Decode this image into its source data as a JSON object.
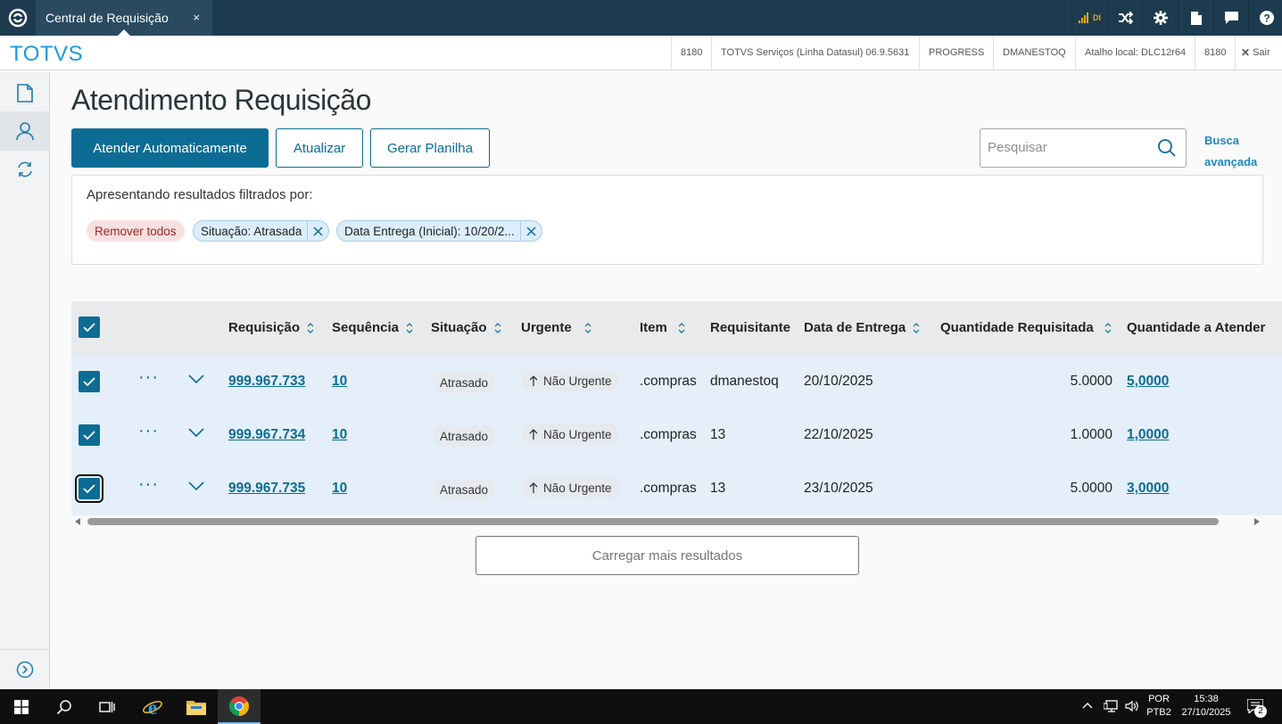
{
  "topbar": {
    "tab_title": "Central de Requisição",
    "tab_close": "×",
    "signal_label": "DI"
  },
  "header": {
    "brand": "TOTVS",
    "info": [
      "8180",
      "TOTVS Serviços (Linha Datasul) 06.9.5631",
      "PROGRESS",
      "DMANESTOQ",
      "Atalho local: DLC12r64",
      "8180"
    ],
    "exit_label": "Sair"
  },
  "page": {
    "title": "Atendimento Requisição",
    "buttons": {
      "auto_attend": "Atender Automaticamente",
      "refresh": "Atualizar",
      "spreadsheet": "Gerar Planilha"
    },
    "search_placeholder": "Pesquisar",
    "advanced_search": [
      "Busca",
      "avançada"
    ]
  },
  "filters": {
    "label": "Apresentando resultados filtrados por:",
    "remove_all": "Remover todos",
    "chips": [
      "Situação: Atrasada",
      "Data Entrega (Inicial): 10/20/2..."
    ]
  },
  "table": {
    "columns": [
      "Requisição",
      "Sequência",
      "Situação",
      "Urgente",
      "Item",
      "Requisitante",
      "Data de Entrega",
      "Quantidade Requisitada",
      "Quantidade a Atender"
    ],
    "rows": [
      {
        "requisicao": "999.967.733",
        "sequencia": "10",
        "situacao": "Atrasado",
        "urgente": "Não Urgente",
        "item": ".compras",
        "requisitante": "dmanestoq",
        "data_entrega": "20/10/2025",
        "qtd_requisitada": "5.0000",
        "qtd_atender": "5,0000"
      },
      {
        "requisicao": "999.967.734",
        "sequencia": "10",
        "situacao": "Atrasado",
        "urgente": "Não Urgente",
        "item": ".compras",
        "requisitante": "13",
        "data_entrega": "22/10/2025",
        "qtd_requisitada": "1.0000",
        "qtd_atender": "1,0000"
      },
      {
        "requisicao": "999.967.735",
        "sequencia": "10",
        "situacao": "Atrasado",
        "urgente": "Não Urgente",
        "item": ".compras",
        "requisitante": "13",
        "data_entrega": "23/10/2025",
        "qtd_requisitada": "5.0000",
        "qtd_atender": "3,0000"
      }
    ],
    "row_menu": "···"
  },
  "load_more": "Carregar mais resultados",
  "taskbar": {
    "lang_top": "POR",
    "lang_bottom": "PTB2",
    "time": "15:38",
    "date": "27/10/2025",
    "notification_count": "2"
  },
  "colors": {
    "primary": "#0c6c94",
    "topbar": "#1d3b4f",
    "row_selected": "#e4effa",
    "brand": "#1b9ad8"
  }
}
